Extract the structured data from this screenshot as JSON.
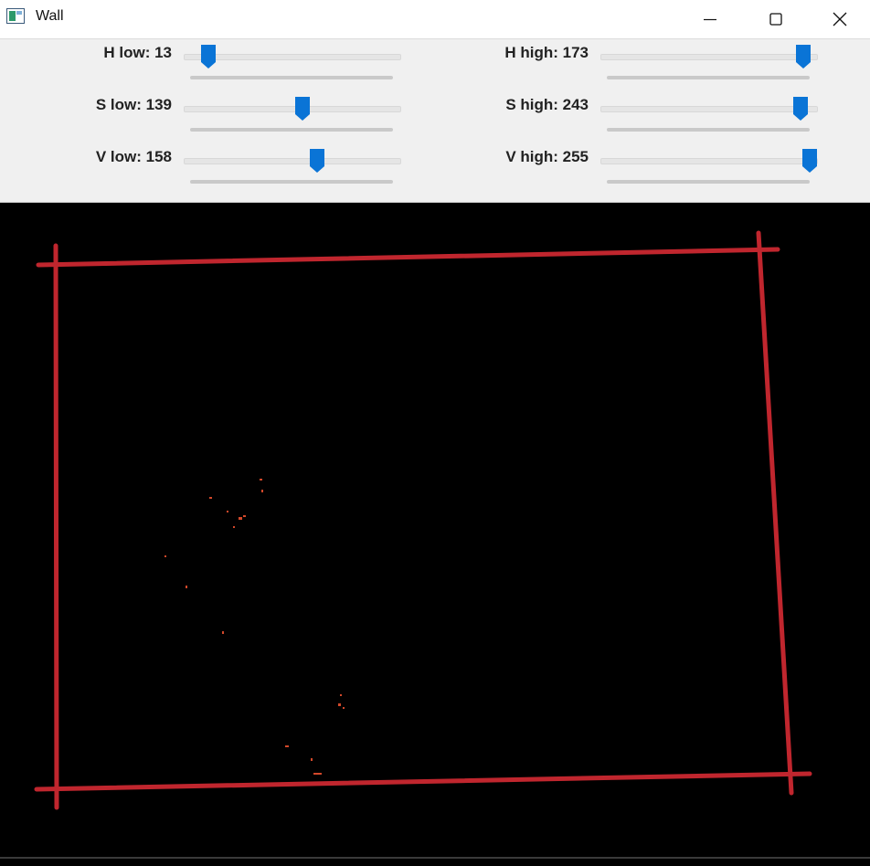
{
  "window": {
    "title": "Wall",
    "icons": {
      "app": "app-window-icon",
      "minimize": "minimize-icon",
      "maximize": "maximize-icon",
      "close": "close-icon"
    }
  },
  "trackbars": [
    {
      "id": "h-low",
      "label": "H low: 13",
      "value": 13,
      "max": 179
    },
    {
      "id": "s-low",
      "label": "S low: 139",
      "value": 139,
      "max": 255
    },
    {
      "id": "v-low",
      "label": "V low: 158",
      "value": 158,
      "max": 255
    },
    {
      "id": "h-high",
      "label": "H high: 173",
      "value": 173,
      "max": 179
    },
    {
      "id": "s-high",
      "label": "S high: 243",
      "value": 243,
      "max": 255
    },
    {
      "id": "v-high",
      "label": "V high: 255",
      "value": 255,
      "max": 255
    }
  ],
  "colors": {
    "slider_thumb": "#0a74d6",
    "mask_lines": "#c0262e",
    "noise": "#d2482a"
  }
}
